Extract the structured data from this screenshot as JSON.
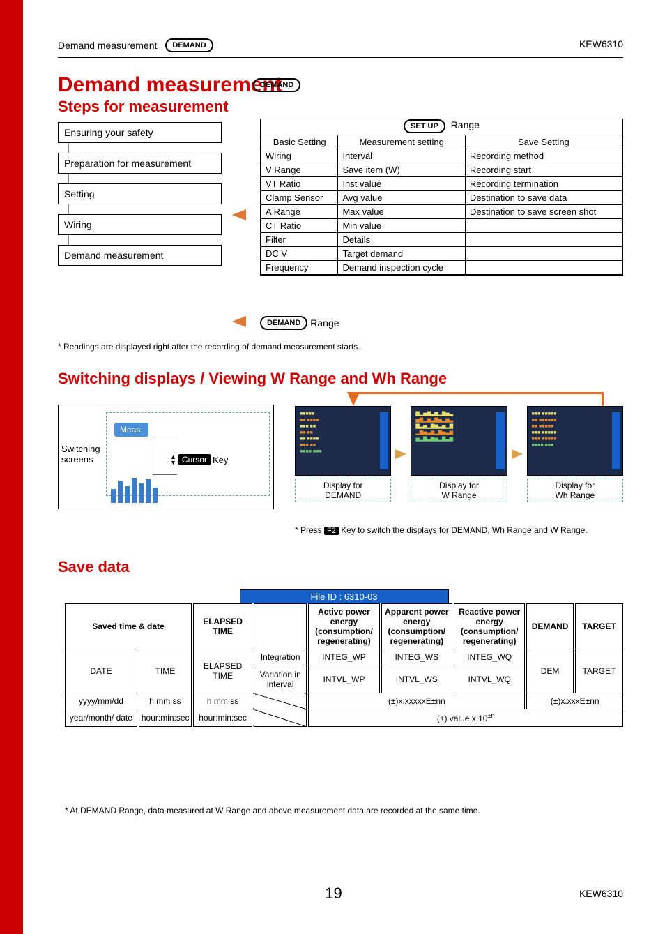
{
  "header": {
    "breadcrumb": "Demand measurement",
    "demand_pill": "DEMAND",
    "model": "KEW6310"
  },
  "title": "Demand measurement",
  "subtitle": "Steps for measurement",
  "flow": {
    "step1": "Ensuring your safety",
    "step2": "Preparation for measurement",
    "step3": "Setting",
    "step4": "Wiring",
    "step5": "Demand measurement"
  },
  "setup": {
    "pill": "SET UP",
    "range_word": "Range",
    "headers": {
      "c1": "Basic Setting",
      "c2": "Measurement setting",
      "c3": "Save Setting"
    },
    "rows": [
      {
        "c1": "Wiring",
        "c2": "Interval",
        "c3": "Recording method"
      },
      {
        "c1": "V Range",
        "c2": "Save item (W)",
        "c3": "Recording start"
      },
      {
        "c1": "VT Ratio",
        "c2": "Inst value",
        "c3": "Recording termination"
      },
      {
        "c1": "Clamp Sensor",
        "c2": "Avg value",
        "c3": "Destination to save data"
      },
      {
        "c1": "A Range",
        "c2": "Max value",
        "c3": "Destination to save screen shot"
      },
      {
        "c1": "CT Ratio",
        "c2": "Min value",
        "c3": ""
      },
      {
        "c1": "Filter",
        "c2": "Details",
        "c3": ""
      },
      {
        "c1": "DC V",
        "c2": "Target demand",
        "c3": ""
      },
      {
        "c1": "Frequency",
        "c2": "Demand inspection cycle",
        "c3": ""
      }
    ]
  },
  "demand_range": {
    "pill": "DEMAND",
    "word": "Range"
  },
  "footnote1": "* Readings are displayed right after the recording of demand measurement starts.",
  "section_switch": "Switching displays / Viewing W Range and Wh Range",
  "switching": {
    "label": "Switching screens",
    "meas": "Meas.",
    "cursor": "Cursor",
    "key_word": "Key"
  },
  "screens": {
    "cap1_a": "Display for",
    "cap1_b": "DEMAND",
    "cap2_a": "Display for",
    "cap2_b": "W Range",
    "cap3_a": "Display for",
    "cap3_b": "Wh Range"
  },
  "footnote2_a": "* Press ",
  "footnote2_key": "F2",
  "footnote2_b": " Key to switch the displays for DEMAND, Wh Range and W Range.",
  "section_save": "Save data",
  "save": {
    "file_id": "File ID : 6310-03",
    "hdr_saved": "Saved time & date",
    "hdr_elapsed": "ELAPSED TIME",
    "hdr_active": "Active power energy (consumption/ regenerating)",
    "hdr_apparent": "Apparent power energy (consumption/ regenerating)",
    "hdr_reactive": "Reactive power energy (consumption/ regenerating)",
    "hdr_demand": "DEMAND",
    "hdr_target": "TARGET",
    "r2_date": "DATE",
    "r2_time": "TIME",
    "r2_elapsed": "ELAPSED TIME",
    "r2_integ": "Integration",
    "r2_var": "Variation in interval",
    "r2_integ_wp": "INTEG_WP",
    "r2_integ_ws": "INTEG_WS",
    "r2_integ_wq": "INTEG_WQ",
    "r2_intvl_wp": "INTVL_WP",
    "r2_intvl_ws": "INTVL_WS",
    "r2_intvl_wq": "INTVL_WQ",
    "r2_dem": "DEM",
    "r2_tar": "TARGET",
    "r3_date": "yyyy/mm/dd",
    "r3_time": "h mm ss",
    "r3_elapsed": "h mm ss",
    "r3_val1": "(±)x.xxxxxE±nn",
    "r3_val2": "(±)x.xxxE±nn",
    "r4_date": "year/month/ date",
    "r4_time": "hour:min:sec",
    "r4_elapsed": "hour:min:sec",
    "r4_val_a": "(±) value x 10",
    "r4_val_sup": "±n"
  },
  "footnote3": "* At DEMAND Range, data measured at W Range and above measurement data are recorded at the same time.",
  "page_number": "19",
  "model_bot": "KEW6310"
}
